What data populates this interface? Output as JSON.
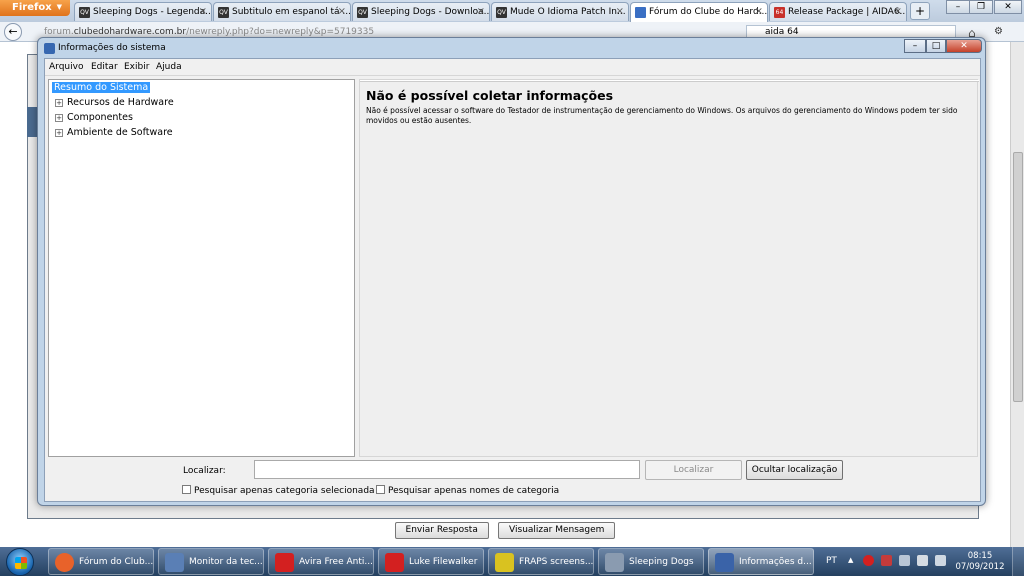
{
  "firefox": {
    "menu_label": "Firefox",
    "tabs": [
      {
        "label": "Sleeping Dogs - Legenda...",
        "fav": "QV"
      },
      {
        "label": "Subtitulo em espanol tá ...",
        "fav": "QV"
      },
      {
        "label": "Sleeping Dogs - Downloa...",
        "fav": "QV"
      },
      {
        "label": "Mude O Idioma Patch In...",
        "fav": "QV"
      },
      {
        "label": "Fórum do Clube do Hard...",
        "fav": ""
      },
      {
        "label": "Release Package | AIDA6...",
        "fav": "64"
      }
    ],
    "url_prefix": "forum.",
    "url_domain": "clubedohardware.com.br",
    "url_path": "/newreply.php?do=newreply&p=5719335",
    "search_value": "aida 64"
  },
  "page": {
    "submit_button": "Enviar Resposta",
    "preview_button": "Visualizar Mensagem"
  },
  "window": {
    "title": "Informações do sistema",
    "menus": [
      "Arquivo",
      "Editar",
      "Exibir",
      "Ajuda"
    ],
    "tree": [
      {
        "label": "Resumo do Sistema",
        "selected": true
      },
      {
        "label": "Recursos de Hardware"
      },
      {
        "label": "Componentes"
      },
      {
        "label": "Ambiente de Software"
      }
    ],
    "detail_title": "Não é possível coletar informações",
    "detail_text": "Não é possível acessar o software do Testador de instrumentação de gerenciamento do Windows. Os arquivos do gerenciamento do Windows podem ter sido movidos ou estão ausentes.",
    "find_label": "Localizar:",
    "find_value": "",
    "find_button": "Localizar",
    "hide_find_button": "Ocultar localização",
    "check_selected_category": "Pesquisar apenas categoria selecionada",
    "check_category_names": "Pesquisar apenas nomes de categoria"
  },
  "taskbar": {
    "tasks": [
      {
        "label": "Fórum do Club...",
        "color": "#e8622a"
      },
      {
        "label": "Monitor da tec...",
        "color": "#5a7fb5"
      },
      {
        "label": "Avira Free Anti...",
        "color": "#d32020"
      },
      {
        "label": "Luke Filewalker",
        "color": "#d32020"
      },
      {
        "label": "FRAPS screens...",
        "color": "#d9c220"
      },
      {
        "label": "Sleeping Dogs",
        "color": "#8a9bb0"
      },
      {
        "label": "Informações d...",
        "color": "#3a63a8"
      }
    ],
    "language": "PT",
    "time": "08:15",
    "date": "07/09/2012"
  }
}
